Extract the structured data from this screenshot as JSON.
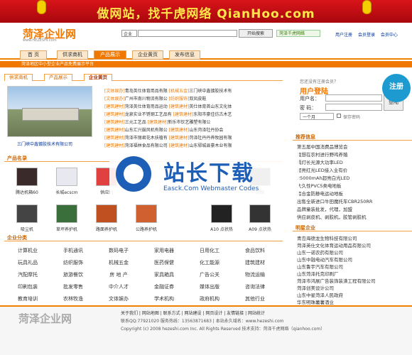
{
  "banner": {
    "text": "做网站，找千虎网络 QianHoo.com"
  },
  "header": {
    "logo": "菏泽企业网",
    "logo_sub": "www.HEZESHI.com",
    "search_select": "企业",
    "search_button": "开始搜索",
    "weixin": "菏泽千虎网络",
    "links": [
      "用户注册",
      "会员登录",
      "会员中心"
    ]
  },
  "nav": {
    "tabs": [
      "首 页",
      "供求商机",
      "产品展示",
      "企业黄页",
      "发布信息"
    ],
    "active": 2
  },
  "subnav": "菏泽地区中小型企业产品免费展示平台",
  "left_tabs": [
    "供求商机",
    "产品展示",
    "企业黄页"
  ],
  "photo_caption": "三门峡中鑫镀胶技术有限公司",
  "news": [
    {
      "c1": "[文体娱办]",
      "t1": "青岛英仕体育用品有限",
      "c2": "[机械五金]",
      "t2": "三门峡中鑫镀胶技术有"
    },
    {
      "c1": "[文体娱办]",
      "t1": "广州市南川物流有限公",
      "c2": "[纺织服饰]",
      "t2": "双凤皮鞋"
    },
    {
      "c1": "[建筑建材]",
      "t1": "菏泽英仕体育用品运动",
      "c2": "[建筑建材]",
      "t2": "英仕体育首山东文化体"
    },
    {
      "c1": "[建筑建材]",
      "t1": "龙泉实业不锈钢工艺品有",
      "c2": "[建筑建材]",
      "t2": "东阳市豪佳仿古木艺"
    },
    {
      "c1": "[建筑建材]",
      "t1": "三元工艺品",
      "c2": "[建筑建材]",
      "t2": "新乐市钦艺雕塑有限公"
    },
    {
      "c1": "[建筑建材]",
      "t1": "山东汇兴鼓风机有限公",
      "c2": "[建筑建材]",
      "t2": "山东菏泽牡丹协会"
    },
    {
      "c1": "[建筑建材]",
      "t1": "菏泽市丽君花木扶植有",
      "c2": "[建筑建材]",
      "t2": "菏泽牡丹丹养牧园有限"
    },
    {
      "c1": "[建筑建材]",
      "t1": "菏泽福林食品有限公司",
      "c2": "[建筑建材]",
      "t2": "山东郓城县豪木业有限"
    }
  ],
  "products_title": "产品名录",
  "products_row1": [
    "腾达机箱60",
    "长城ecscm",
    "供应制",
    "",
    "",
    ""
  ],
  "products_row2": [
    "吸尘机",
    "草坪养护机",
    "路面养护机",
    "公路养护机",
    "A10 点状热",
    "A09 点状热"
  ],
  "products_extra": "机械",
  "cats_title": "企业分类",
  "cats": [
    [
      "计算机业",
      "手机通讯",
      "数码电子",
      "家用电器",
      "日用化工",
      "食品饮料"
    ],
    [
      "玩具礼品",
      "纺织服饰",
      "机械五金",
      "医药保健",
      "化工能源",
      "建筑建材"
    ],
    [
      "汽配摩托",
      "旅游餐饮",
      "房 地 产",
      "家具箱具",
      "广告公关",
      "物流运输"
    ],
    [
      "印刷包装",
      "批发零售",
      "中介人才",
      "金融证券",
      "媒体出版",
      "咨询法律"
    ],
    [
      "教育培训",
      "农林牧渔",
      "文体娱办",
      "学术机构",
      "政府机构",
      "其他行业"
    ]
  ],
  "login": {
    "tip": "您还没有注册会员？",
    "title": "用户登陆",
    "user_label": "用户名：",
    "pwd_label": "密  码：",
    "period": "一个月",
    "remember": "保存密码",
    "login_button": "登陆",
    "register": "注册"
  },
  "recommend_title": "推荐信息",
  "recommend": [
    "第五届中国消费品博览会",
    "我想在农村进行野鸡养殖",
    "隔灯长光源大功率LED",
    "超亮红光LED接入业有价",
    "25000mAh超亮白光LED",
    "大久性PVC5类电地板",
    "铝合金防静电运动地板",
    "出售全新进口牛田魔托车CBR250RR",
    "品牌童装批发，代理，加盟",
    "供应剥皮机、剥胶机，胶管剥胶机"
  ],
  "star_title": "明星企业",
  "star": [
    "青岛海德龙生物科技有限公司",
    "菏泽英仕文化体育运动用品有限公司",
    "山东一诺农药有限公司",
    "山东中融电动汽车有限公司",
    "山东鲁宇汽车有限公司",
    "山东菏泽托克印刷厂",
    "菏泽市鸿展广告装饰装潢工程有限公司",
    "菏泽创美设计公司",
    "山东中星菏泽人民政府",
    "华东明珠薯薯酒业"
  ],
  "footer": {
    "logo": "菏泽企业网",
    "links": "关于我们 | 网站地图 | 联系方式 | 网站建设 | 网页设计 | 友情链接 | 网站统计",
    "line2": "联系QQ:77921020  服务热线：13563871683 | 本站永久域名：www.hezeshi.com",
    "line3": "Copyright (c) 2008 hezeshi.com Inc. All Rights Reserved  技术支持：菏泽千虎网络（qianhoo.com）"
  },
  "watermark": {
    "title": "站长下载",
    "sub": "Easck.Com Webmaster Codes"
  }
}
